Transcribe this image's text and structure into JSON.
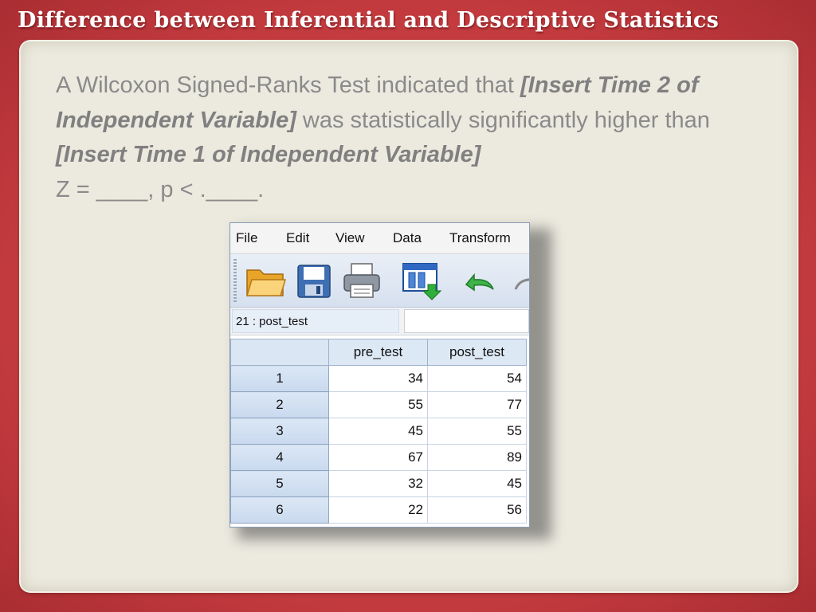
{
  "slide": {
    "title": "Difference between Inferential and Descriptive Statistics",
    "body": {
      "t1": "A Wilcoxon Signed-Ranks Test indicated that ",
      "ph1": "[Insert Time 2 of Independent Variable]",
      "t2": " was statistically significantly higher than ",
      "ph2": "[Insert Time 1 of Independent Variable]",
      "stat_line": "Z = ____, p < .____."
    }
  },
  "spss": {
    "menu": [
      "File",
      "Edit",
      "View",
      "Data",
      "Transform"
    ],
    "toolbar_icons": [
      "open-folder-icon",
      "save-icon",
      "print-icon",
      "goto-data-icon",
      "undo-icon"
    ],
    "cell_ref": "21 : post_test",
    "cell_value": "",
    "columns": [
      "pre_test",
      "post_test"
    ],
    "rows": [
      {
        "n": "1",
        "pre_test": "34",
        "post_test": "54"
      },
      {
        "n": "2",
        "pre_test": "55",
        "post_test": "77"
      },
      {
        "n": "3",
        "pre_test": "45",
        "post_test": "55"
      },
      {
        "n": "4",
        "pre_test": "67",
        "post_test": "89"
      },
      {
        "n": "5",
        "pre_test": "32",
        "post_test": "45"
      },
      {
        "n": "6",
        "pre_test": "22",
        "post_test": "56"
      }
    ]
  },
  "colors": {
    "frame": "#c23a3e",
    "panel": "#eceadf",
    "body_text": "#8a8a8a"
  }
}
